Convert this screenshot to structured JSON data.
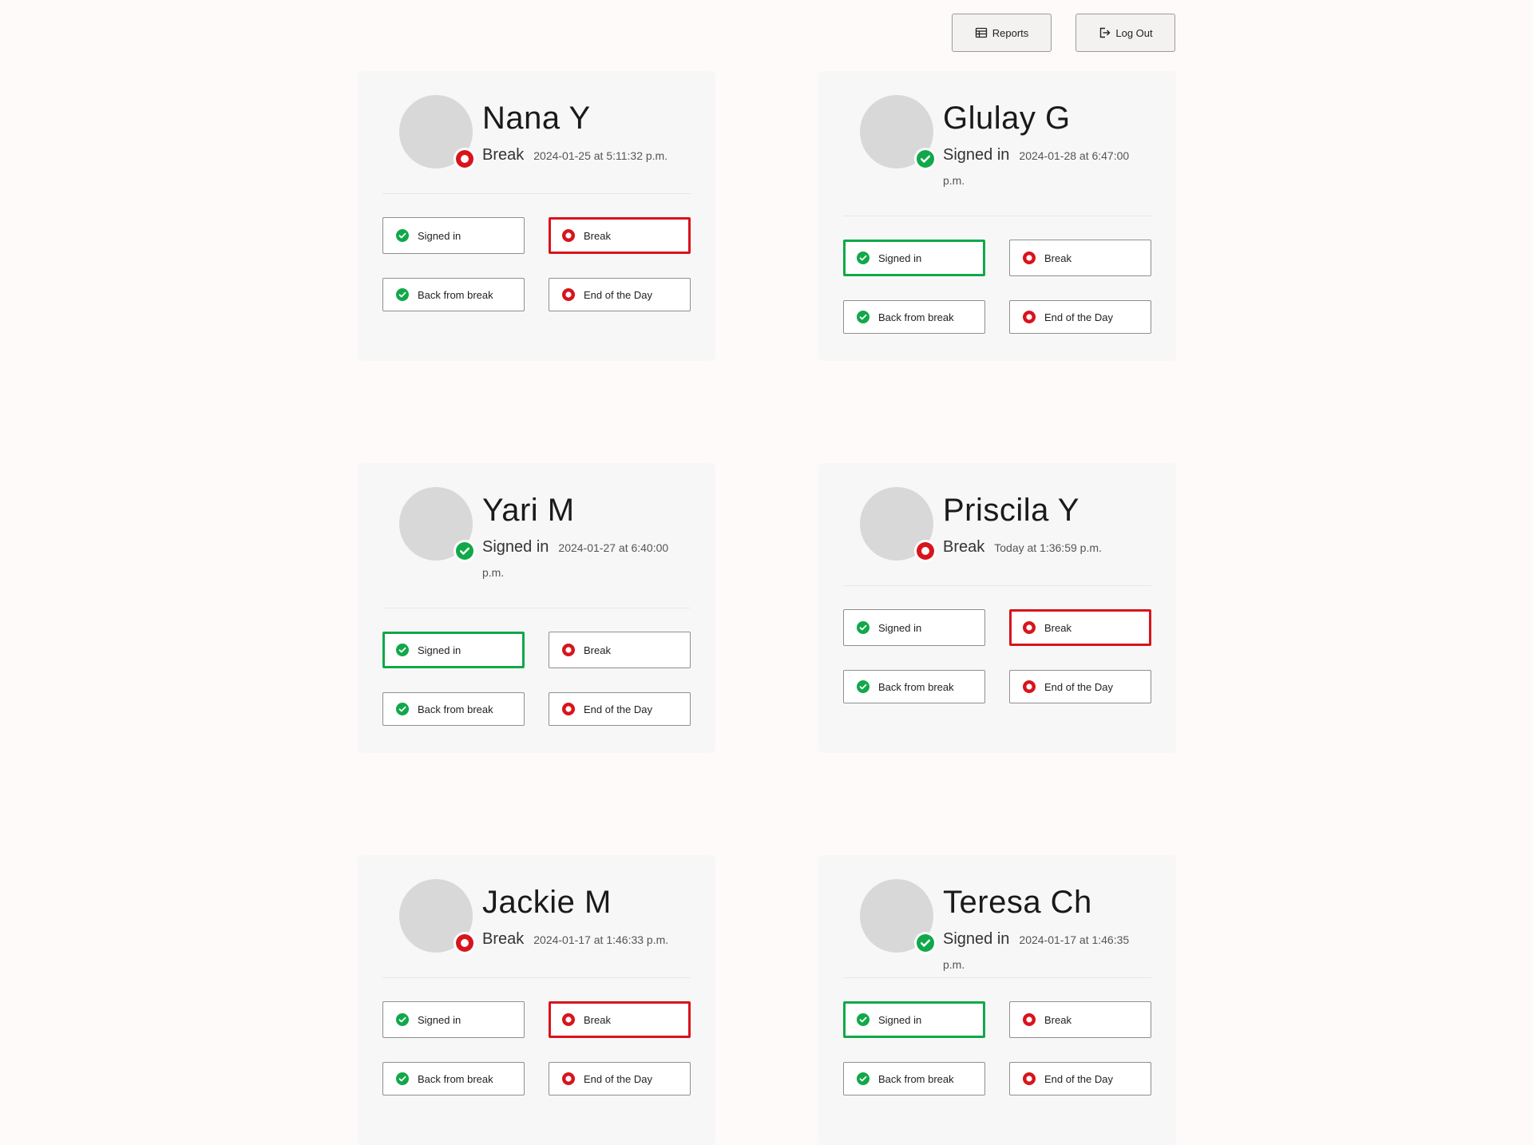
{
  "colors": {
    "green": "#11a84a",
    "red": "#d8141c",
    "card_bg": "#f7f7f7"
  },
  "topbar": {
    "reports_label": "Reports",
    "reports_icon": "table-icon",
    "logout_label": "Log Out",
    "logout_icon": "logout-icon"
  },
  "buttons": {
    "signed_in": "Signed in",
    "break": "Break",
    "back_from_break": "Back from break",
    "end_of_day": "End of the Day"
  },
  "employees": [
    {
      "name": "Nana Y",
      "status": "Break",
      "status_type": "red",
      "time": "2024-01-25 at 5:11:32 p.m.",
      "active_button": "break"
    },
    {
      "name": "Glulay G",
      "status": "Signed in",
      "status_type": "green",
      "time": "2024-01-28 at 6:47:00 p.m.",
      "active_button": "signed_in"
    },
    {
      "name": "Yari M",
      "status": "Signed in",
      "status_type": "green",
      "time": "2024-01-27 at 6:40:00 p.m.",
      "active_button": "signed_in"
    },
    {
      "name": "Priscila Y",
      "status": "Break",
      "status_type": "red",
      "time": "Today at 1:36:59 p.m.",
      "active_button": "break"
    },
    {
      "name": "Jackie M",
      "status": "Break",
      "status_type": "red",
      "time": "2024-01-17 at 1:46:33 p.m.",
      "active_button": "break"
    },
    {
      "name": "Teresa Ch",
      "status": "Signed in",
      "status_type": "green",
      "time": "2024-01-17 at 1:46:35 p.m.",
      "active_button": "signed_in"
    }
  ]
}
